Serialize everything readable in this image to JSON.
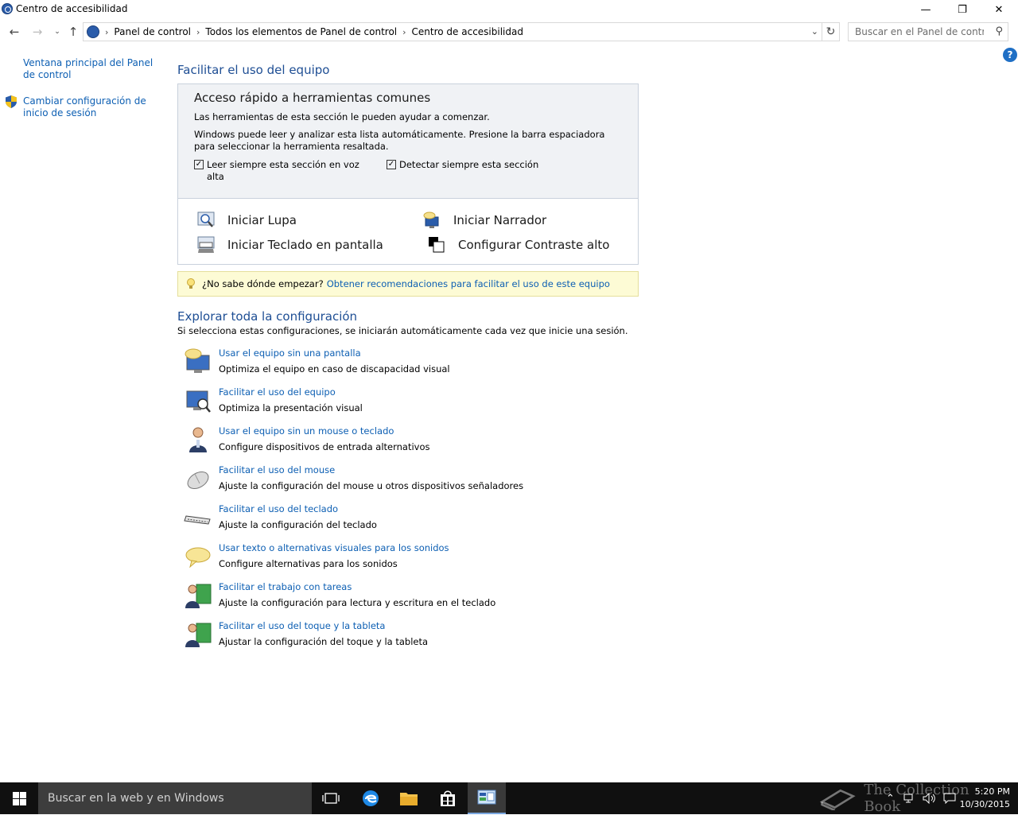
{
  "window": {
    "title": "Centro de accesibilidad",
    "minimize": "—",
    "maximize": "❐",
    "close": "✕"
  },
  "address": {
    "breadcrumbs": [
      "Panel de control",
      "Todos los elementos de Panel de control",
      "Centro de accesibilidad"
    ],
    "search_placeholder": "Buscar en el Panel de control"
  },
  "left_nav": {
    "home_link": "Ventana principal del Panel de control",
    "logon_link": "Cambiar configuración de inicio de sesión"
  },
  "main": {
    "heading": "Facilitar el uso del equipo",
    "quick_access": {
      "title": "Acceso rápido a herramientas comunes",
      "intro": "Las herramientas de esta sección le pueden ayudar a comenzar.",
      "scan_info": "Windows puede leer y analizar esta lista automáticamente. Presione la barra espaciadora para seleccionar la herramienta resaltada.",
      "read_aloud": "Leer siempre esta sección en voz alta",
      "read_aloud_checked": true,
      "scan_always": "Detectar siempre esta sección",
      "scan_always_checked": true,
      "tools": {
        "magnifier": "Iniciar Lupa",
        "narrator": "Iniciar Narrador",
        "osk": "Iniciar Teclado en pantalla",
        "contrast": "Configurar Contraste alto"
      }
    },
    "tip": {
      "question": "¿No sabe dónde empezar?",
      "link": "Obtener recomendaciones para facilitar el uso de este equipo"
    },
    "explore": {
      "heading": "Explorar toda la configuración",
      "subtitle": "Si selecciona estas configuraciones, se iniciarán automáticamente cada vez que inicie una sesión.",
      "items": [
        {
          "link": "Usar el equipo sin una pantalla",
          "desc": "Optimiza el equipo en caso de discapacidad visual",
          "icon": "monitor-speech-icon"
        },
        {
          "link": "Facilitar el uso del equipo",
          "desc": "Optimiza la presentación visual",
          "icon": "monitor-magnifier-icon"
        },
        {
          "link": "Usar el equipo sin un mouse o teclado",
          "desc": "Configure dispositivos de entrada alternativos",
          "icon": "person-icon"
        },
        {
          "link": "Facilitar el uso del mouse",
          "desc": "Ajuste la configuración del mouse u otros dispositivos señaladores",
          "icon": "mouse-icon"
        },
        {
          "link": "Facilitar el uso del teclado",
          "desc": "Ajuste la configuración del teclado",
          "icon": "keyboard-icon"
        },
        {
          "link": "Usar texto o alternativas visuales para los sonidos",
          "desc": "Configure alternativas para los sonidos",
          "icon": "speech-bubble-icon"
        },
        {
          "link": "Facilitar el trabajo con tareas",
          "desc": "Ajuste la configuración para lectura y escritura en el teclado",
          "icon": "users-board-icon"
        },
        {
          "link": "Facilitar el uso del toque y la tableta",
          "desc": "Ajustar la configuración del toque y la tableta",
          "icon": "users-board-icon"
        }
      ]
    }
  },
  "taskbar": {
    "search_placeholder": "Buscar en la web y en Windows",
    "time": "5:20 PM",
    "date": "10/30/2015",
    "watermark": "The Collection Book"
  },
  "colors": {
    "link": "#0d5fb3",
    "heading": "#1e4e94",
    "tip_bg": "#fdfbd5",
    "taskbar": "#101010"
  }
}
